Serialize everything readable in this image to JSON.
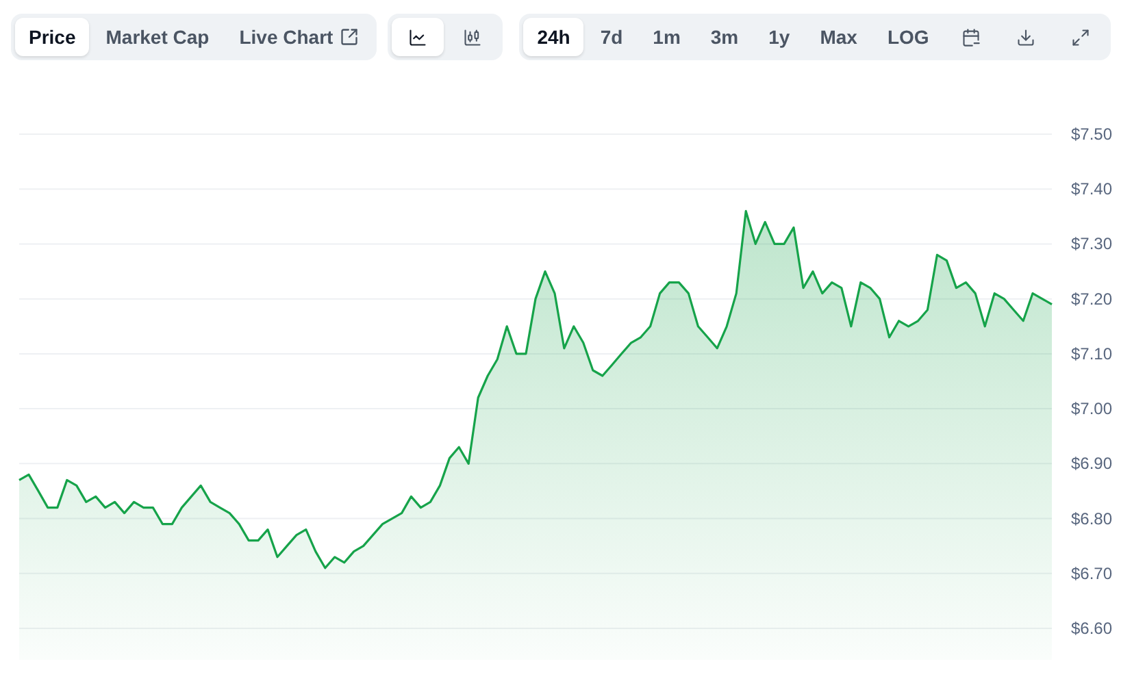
{
  "tabs": [
    {
      "label": "Price",
      "selected": true,
      "kind": "plain"
    },
    {
      "label": "Market Cap",
      "selected": false,
      "kind": "plain"
    },
    {
      "label": "Live Chart",
      "selected": false,
      "kind": "external"
    }
  ],
  "chart_types": [
    {
      "kind": "line",
      "selected": true
    },
    {
      "kind": "candlestick",
      "selected": false
    }
  ],
  "ranges": [
    {
      "label": "24h",
      "selected": true
    },
    {
      "label": "7d",
      "selected": false
    },
    {
      "label": "1m",
      "selected": false
    },
    {
      "label": "3m",
      "selected": false
    },
    {
      "label": "1y",
      "selected": false
    },
    {
      "label": "Max",
      "selected": false
    },
    {
      "label": "LOG",
      "selected": false
    }
  ],
  "tools": [
    {
      "kind": "calendar"
    },
    {
      "kind": "download"
    },
    {
      "kind": "expand"
    }
  ],
  "chart_data": {
    "type": "area",
    "grid": true,
    "ylim": [
      6.6,
      7.5
    ],
    "yticks": [
      {
        "value": 7.5,
        "label": "$7.50"
      },
      {
        "value": 7.4,
        "label": "$7.40"
      },
      {
        "value": 7.3,
        "label": "$7.30"
      },
      {
        "value": 7.2,
        "label": "$7.20"
      },
      {
        "value": 7.1,
        "label": "$7.10"
      },
      {
        "value": 7.0,
        "label": "$7.00"
      },
      {
        "value": 6.9,
        "label": "$6.90"
      },
      {
        "value": 6.8,
        "label": "$6.80"
      },
      {
        "value": 6.7,
        "label": "$6.70"
      },
      {
        "value": 6.6,
        "label": "$6.60"
      }
    ],
    "series": [
      {
        "color": "#16a34a",
        "values": [
          6.87,
          6.88,
          6.85,
          6.82,
          6.82,
          6.87,
          6.86,
          6.83,
          6.84,
          6.82,
          6.83,
          6.81,
          6.83,
          6.82,
          6.82,
          6.79,
          6.79,
          6.82,
          6.84,
          6.86,
          6.83,
          6.82,
          6.81,
          6.79,
          6.76,
          6.76,
          6.78,
          6.73,
          6.75,
          6.77,
          6.78,
          6.74,
          6.71,
          6.73,
          6.72,
          6.74,
          6.75,
          6.77,
          6.79,
          6.8,
          6.81,
          6.84,
          6.82,
          6.83,
          6.86,
          6.91,
          6.93,
          6.9,
          7.02,
          7.06,
          7.09,
          7.15,
          7.1,
          7.1,
          7.2,
          7.25,
          7.21,
          7.11,
          7.15,
          7.12,
          7.07,
          7.06,
          7.08,
          7.1,
          7.12,
          7.13,
          7.15,
          7.21,
          7.23,
          7.23,
          7.21,
          7.15,
          7.13,
          7.11,
          7.15,
          7.21,
          7.36,
          7.3,
          7.34,
          7.3,
          7.3,
          7.33,
          7.22,
          7.25,
          7.21,
          7.23,
          7.22,
          7.15,
          7.23,
          7.22,
          7.2,
          7.13,
          7.16,
          7.15,
          7.16,
          7.18,
          7.28,
          7.27,
          7.22,
          7.23,
          7.21,
          7.15,
          7.21,
          7.2,
          7.18,
          7.16,
          7.21,
          7.2,
          7.19
        ]
      }
    ]
  }
}
